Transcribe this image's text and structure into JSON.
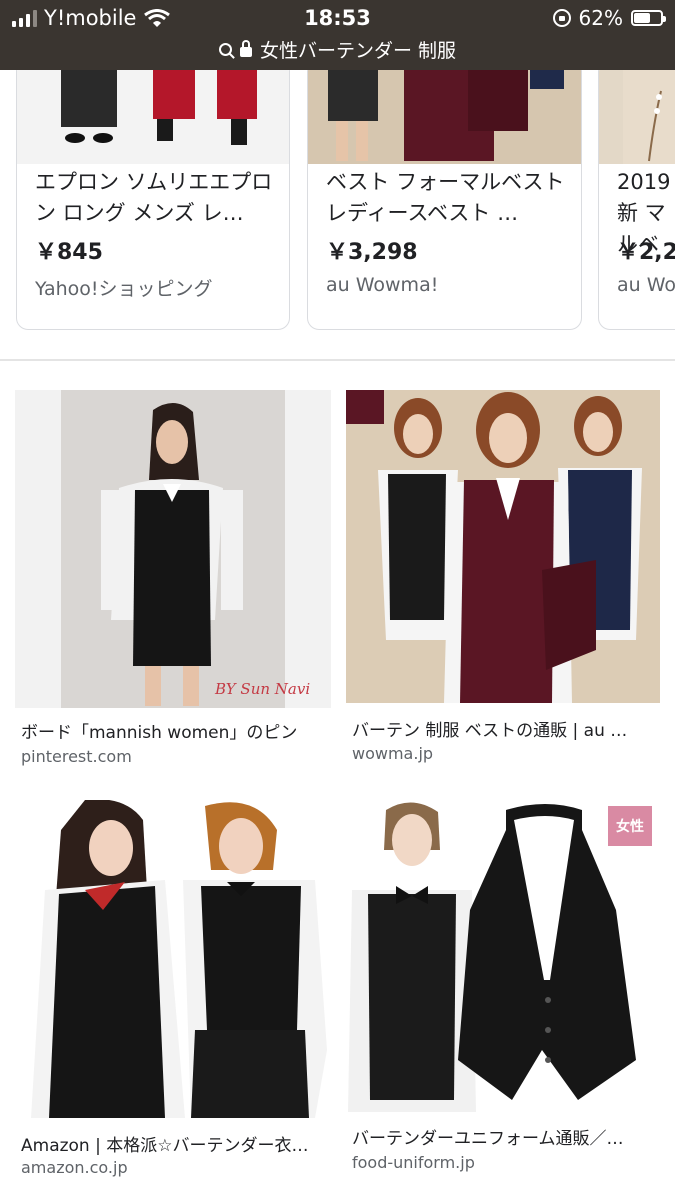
{
  "status_bar": {
    "carrier": "Y!mobile",
    "time": "18:53",
    "battery_percent": "62%",
    "battery_level": 0.62,
    "url_text": "女性バーテンダー 制服"
  },
  "shopping_cards": [
    {
      "title": "エプロン ソムリエエプロン ロング メンズ レ…",
      "price": "￥845",
      "store": "Yahoo!ショッピング"
    },
    {
      "title": "ベスト フォーマルベスト レディースベスト …",
      "price": "￥3,298",
      "store": "au Wowma!"
    },
    {
      "title": "2019新 マルベ",
      "price": "￥2,2",
      "store": "au Wo"
    }
  ],
  "image_results": [
    {
      "caption": "ボード「mannish women」のピン",
      "source": "pinterest.com",
      "watermark": "BY Sun Navi"
    },
    {
      "caption": "バーテン 制服 ベストの通販 | au …",
      "source": "wowma.jp"
    },
    {
      "caption": "Amazon | 本格派☆バーテンダー衣…",
      "source": "amazon.co.jp"
    },
    {
      "caption": "バーテンダーユニフォーム通販／…",
      "source": "food-uniform.jp",
      "badge": "女性"
    }
  ],
  "colors": {
    "status_bar_bg": "#3a3530",
    "card_border": "#dadce0",
    "source_text": "#5f6368",
    "badge_pink": "#d98aa3"
  }
}
